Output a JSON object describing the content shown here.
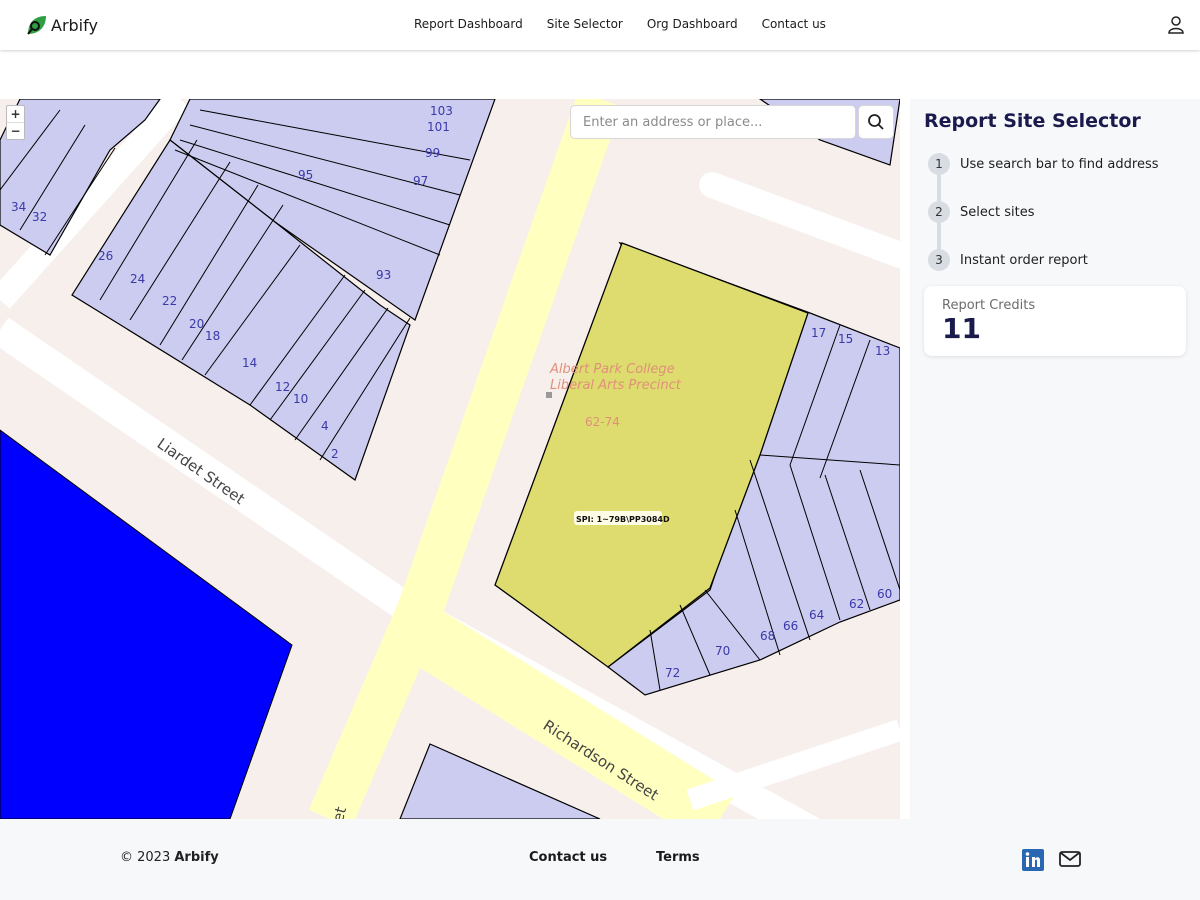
{
  "brand": {
    "name": "Arbify",
    "accent": "#2f9e44"
  },
  "nav": {
    "items": [
      "Report Dashboard",
      "Site Selector",
      "Org Dashboard",
      "Contact us"
    ]
  },
  "header": {
    "user_icon": "user-icon"
  },
  "map": {
    "search": {
      "placeholder": "Enter an address or place...",
      "value": ""
    },
    "zoom_in": "+",
    "zoom_out": "−",
    "site_name": "Albert Park College",
    "site_name_2": "Liberal Arts Precinct",
    "site_number": "62-74",
    "spi_label": "SPI: 1~79B\\PP3084D",
    "streets": {
      "liardet": "Liardet Street",
      "richardson": "Richardson Street",
      "bottom": "eet"
    },
    "lots": [
      "103",
      "101",
      "99",
      "97",
      "95",
      "93",
      "34",
      "32",
      "26",
      "24",
      "22",
      "20",
      "18",
      "14",
      "12",
      "10",
      "4",
      "2",
      "17",
      "15",
      "13",
      "72",
      "70",
      "68",
      "66",
      "64",
      "62",
      "60"
    ],
    "colors": {
      "parcel": "#cccbf0",
      "selected": "#dedc6e",
      "water": "#0000ff",
      "road": "#ffffc0",
      "ground": "#f7efec"
    }
  },
  "sidebar": {
    "title": "Report Site Selector",
    "steps": [
      {
        "num": "1",
        "text": "Use search bar to find address"
      },
      {
        "num": "2",
        "text": "Select sites"
      },
      {
        "num": "3",
        "text": "Instant order report"
      }
    ],
    "credits": {
      "label": "Report Credits",
      "value": "11"
    }
  },
  "footer": {
    "copyright": "© 2023",
    "brand": "Arbify",
    "contact": "Contact us",
    "terms": "Terms",
    "icons": [
      "linkedin-icon",
      "mail-icon"
    ]
  }
}
